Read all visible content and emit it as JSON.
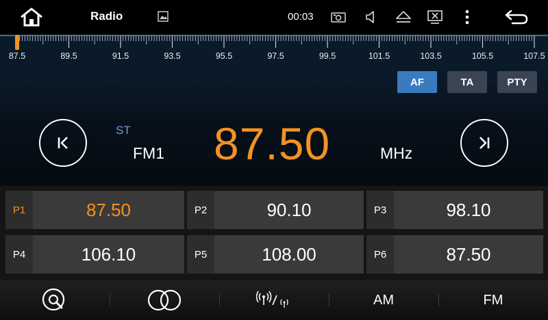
{
  "status_bar": {
    "title": "Radio",
    "time": "00:03"
  },
  "tuner": {
    "scale_labels": [
      "87.5",
      "89.5",
      "91.5",
      "93.5",
      "95.5",
      "97.5",
      "99.5",
      "101.5",
      "103.5",
      "105.5",
      "107.5"
    ],
    "af_label": "AF",
    "ta_label": "TA",
    "pty_label": "PTY",
    "af_active": true,
    "stereo": "ST",
    "band": "FM1",
    "frequency": "87.50",
    "unit": "MHz"
  },
  "presets": [
    {
      "label": "P1",
      "freq": "87.50",
      "active": true
    },
    {
      "label": "P2",
      "freq": "90.10",
      "active": false
    },
    {
      "label": "P3",
      "freq": "98.10",
      "active": false
    },
    {
      "label": "P4",
      "freq": "106.10",
      "active": false
    },
    {
      "label": "P5",
      "freq": "108.00",
      "active": false
    },
    {
      "label": "P6",
      "freq": "87.50",
      "active": false
    }
  ],
  "bottom_bar": {
    "am_label": "AM",
    "fm_label": "FM"
  },
  "colors": {
    "accent": "#f39222",
    "af_active": "#3a7bbf",
    "stereo": "#6f9bd3"
  },
  "icons": [
    "home-icon",
    "picture-icon",
    "camera-icon",
    "volume-icon",
    "eject-icon",
    "screen-close-icon",
    "more-icon",
    "back-icon",
    "seek-prev-icon",
    "seek-next-icon",
    "search-icon",
    "loudness-icon",
    "broadcast-icon"
  ]
}
